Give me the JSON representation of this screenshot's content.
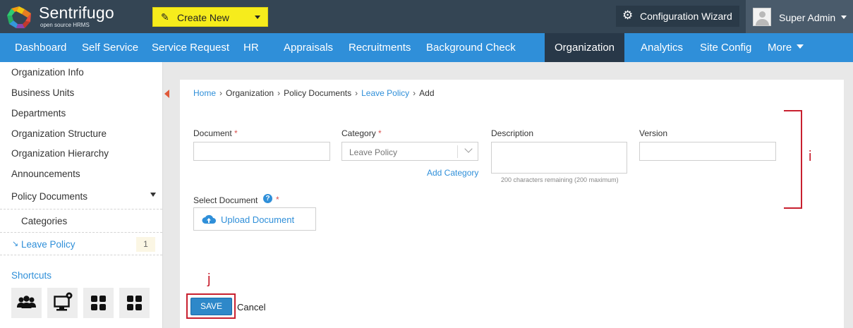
{
  "brand": {
    "name": "Sentrifugo",
    "tagline": "open source HRMS"
  },
  "topbar": {
    "create_new_label": "Create New",
    "config_wizard_label": "Configuration Wizard",
    "user_name": "Super Admin"
  },
  "nav": {
    "items": [
      {
        "label": "Dashboard"
      },
      {
        "label": "Self Service"
      },
      {
        "label": "Service Request"
      },
      {
        "label": "HR"
      },
      {
        "label": "Appraisals"
      },
      {
        "label": "Recruitments"
      },
      {
        "label": "Background Check"
      },
      {
        "label": "Organization",
        "active": true
      },
      {
        "label": "Analytics"
      },
      {
        "label": "Site Config"
      },
      {
        "label": "More"
      }
    ]
  },
  "sidebar": {
    "items": [
      {
        "label": "Organization Info"
      },
      {
        "label": "Business Units"
      },
      {
        "label": "Departments"
      },
      {
        "label": "Organization Structure"
      },
      {
        "label": "Organization Hierarchy"
      },
      {
        "label": "Announcements"
      },
      {
        "label": "Policy Documents"
      }
    ],
    "subitems": [
      {
        "label": "Categories"
      },
      {
        "label": "Leave Policy",
        "count": "1",
        "selected": true
      }
    ],
    "shortcuts_label": "Shortcuts",
    "shortcut_icons": [
      "people-group-icon",
      "monitor-settings-icon",
      "grid-icon",
      "grid-icon"
    ]
  },
  "breadcrumb": {
    "items": [
      {
        "label": "Home",
        "link": true
      },
      {
        "label": "Organization",
        "link": false
      },
      {
        "label": "Policy Documents",
        "link": false
      },
      {
        "label": "Leave Policy",
        "link": true
      },
      {
        "label": "Add",
        "link": false
      }
    ],
    "separator": "›"
  },
  "form": {
    "document": {
      "label": "Document",
      "required_mark": "*",
      "value": ""
    },
    "category": {
      "label": "Category",
      "required_mark": "*",
      "selected": "Leave Policy",
      "add_link": "Add Category"
    },
    "description": {
      "label": "Description",
      "value": "",
      "hint": "200 characters remaining (200 maximum)"
    },
    "version": {
      "label": "Version",
      "value": ""
    },
    "select_document": {
      "label": "Select Document",
      "help_glyph": "?",
      "required_mark": "*",
      "upload_label": "Upload Document"
    },
    "save_label": "SAVE",
    "cancel_label": "Cancel"
  },
  "annotations": {
    "bracket_label": "i",
    "box_label": "j"
  },
  "colors": {
    "topbar": "#344554",
    "nav": "#2f8fd9",
    "nav_active": "#283848",
    "create_new": "#f6ec1c",
    "link": "#2f8fd9",
    "annotation": "#c8202f"
  }
}
